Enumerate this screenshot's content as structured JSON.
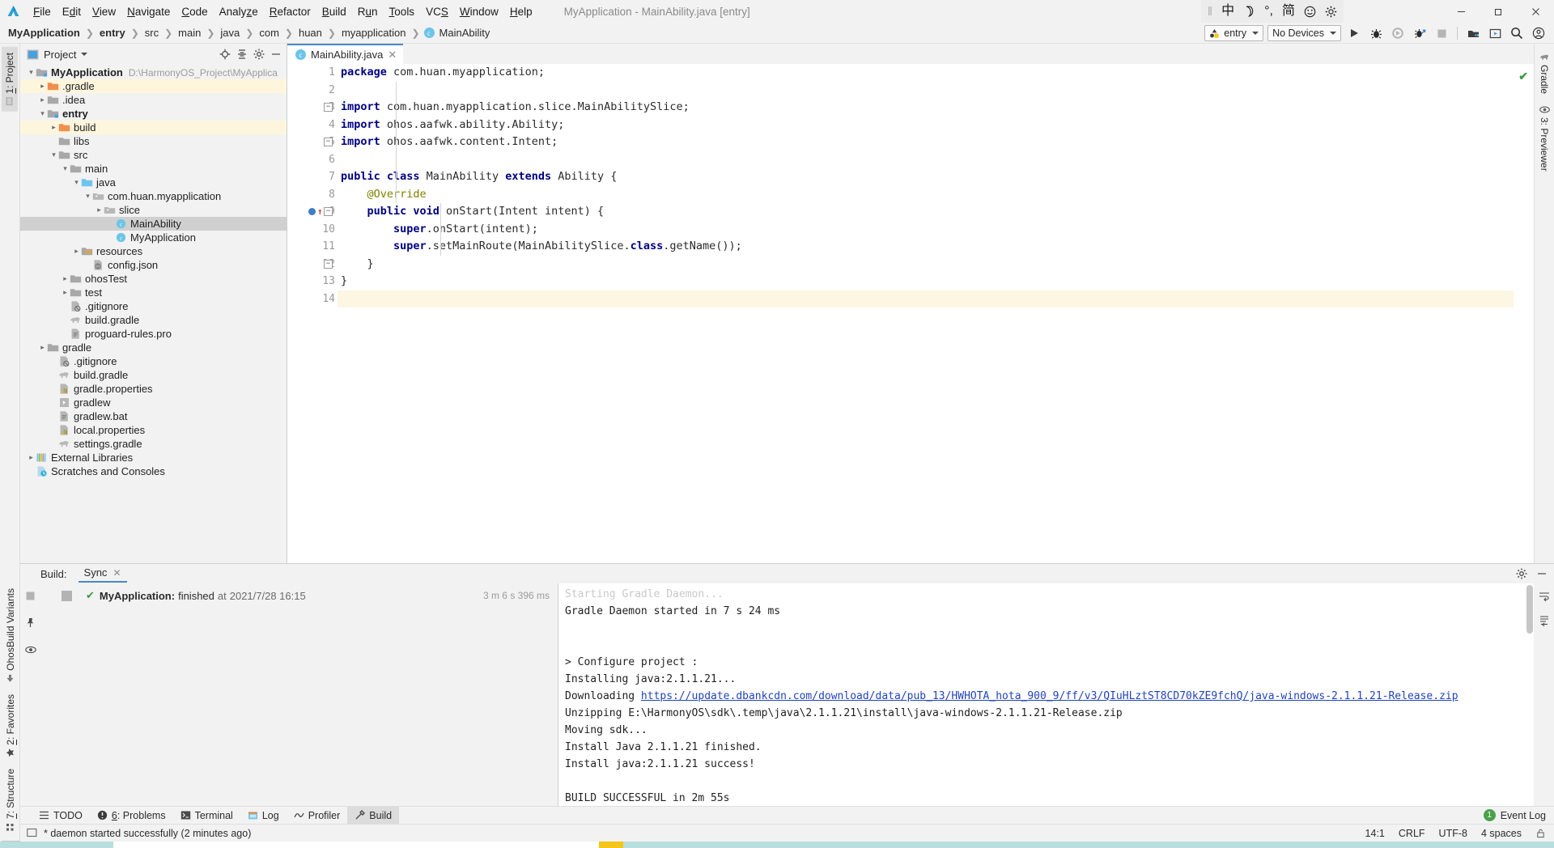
{
  "window": {
    "title": "MyApplication - MainAbility.java [entry]",
    "minimize": "—",
    "maximize": "❐",
    "close": "✕"
  },
  "menu": {
    "items": [
      {
        "label": "File",
        "mnemonic": "F"
      },
      {
        "label": "Edit",
        "mnemonic": "E"
      },
      {
        "label": "View",
        "mnemonic": "V"
      },
      {
        "label": "Navigate",
        "mnemonic": "N"
      },
      {
        "label": "Code",
        "mnemonic": "C"
      },
      {
        "label": "Analyze",
        "mnemonic": "z"
      },
      {
        "label": "Refactor",
        "mnemonic": "R"
      },
      {
        "label": "Build",
        "mnemonic": "B"
      },
      {
        "label": "Run",
        "mnemonic": "u"
      },
      {
        "label": "Tools",
        "mnemonic": "T"
      },
      {
        "label": "VCS",
        "mnemonic": "S"
      },
      {
        "label": "Window",
        "mnemonic": "W"
      },
      {
        "label": "Help",
        "mnemonic": "H"
      }
    ]
  },
  "ime": {
    "items": [
      "中",
      "☽",
      "°,",
      "简",
      "☺",
      "⚙"
    ]
  },
  "breadcrumb": {
    "items": [
      "MyApplication",
      "entry",
      "src",
      "main",
      "java",
      "com",
      "huan",
      "myapplication",
      "MainAbility"
    ],
    "class_badge": "c"
  },
  "toolbar": {
    "module_selector": "entry",
    "device_selector": "No Devices",
    "run_title": "Run",
    "debug_title": "Debug",
    "run_coverage_title": "Run with Coverage",
    "profile_title": "Profile",
    "stop_title": "Stop",
    "sdk_manager_title": "SDK Manager",
    "previewer_title": "Previewer",
    "search_title": "Search Everywhere",
    "account_title": "Account"
  },
  "left_rail": {
    "top": [
      {
        "label": "1: Project",
        "mnemonic": "1",
        "selected": true
      }
    ],
    "bottom": [
      {
        "label": "7: Structure",
        "mnemonic": "7"
      },
      {
        "label": "2: Favorites",
        "mnemonic": "2"
      },
      {
        "label": "OhosBuild Variants",
        "mnemonic": ""
      }
    ]
  },
  "right_rail": {
    "items": [
      {
        "label": "Gradle"
      },
      {
        "label": "3: Previewer",
        "mnemonic": "3"
      }
    ]
  },
  "project_panel": {
    "title": "Project",
    "locate_title": "Select Opened File",
    "collapse_title": "Collapse All",
    "settings_title": "Settings",
    "hide_title": "Hide",
    "root_path": "D:\\HarmonyOS_Project\\MyApplica",
    "tree": [
      {
        "label": "MyApplication",
        "depth": 0,
        "arrow": "v",
        "icon": "module",
        "bold": true,
        "path": true
      },
      {
        "label": ".gradle",
        "depth": 1,
        "arrow": ">",
        "icon": "folder-orange",
        "hl": true
      },
      {
        "label": ".idea",
        "depth": 1,
        "arrow": ">",
        "icon": "folder"
      },
      {
        "label": "entry",
        "depth": 1,
        "arrow": "v",
        "icon": "module",
        "bold": true
      },
      {
        "label": "build",
        "depth": 2,
        "arrow": ">",
        "icon": "folder-orange",
        "hl": true
      },
      {
        "label": "libs",
        "depth": 2,
        "arrow": "",
        "icon": "folder"
      },
      {
        "label": "src",
        "depth": 2,
        "arrow": "v",
        "icon": "folder"
      },
      {
        "label": "main",
        "depth": 3,
        "arrow": "v",
        "icon": "folder"
      },
      {
        "label": "java",
        "depth": 4,
        "arrow": "v",
        "icon": "folder-blue"
      },
      {
        "label": "com.huan.myapplication",
        "depth": 5,
        "arrow": "v",
        "icon": "package"
      },
      {
        "label": "slice",
        "depth": 6,
        "arrow": ">",
        "icon": "package"
      },
      {
        "label": "MainAbility",
        "depth": 7,
        "arrow": "",
        "icon": "class",
        "selected": true
      },
      {
        "label": "MyApplication",
        "depth": 7,
        "arrow": "",
        "icon": "class"
      },
      {
        "label": "resources",
        "depth": 4,
        "arrow": ">",
        "icon": "folder-res"
      },
      {
        "label": "config.json",
        "depth": 5,
        "arrow": "",
        "icon": "json"
      },
      {
        "label": "ohosTest",
        "depth": 3,
        "arrow": ">",
        "icon": "folder"
      },
      {
        "label": "test",
        "depth": 3,
        "arrow": ">",
        "icon": "folder"
      },
      {
        "label": ".gitignore",
        "depth": 3,
        "arrow": "",
        "icon": "gitignore"
      },
      {
        "label": "build.gradle",
        "depth": 3,
        "arrow": "",
        "icon": "gradle"
      },
      {
        "label": "proguard-rules.pro",
        "depth": 3,
        "arrow": "",
        "icon": "file"
      },
      {
        "label": "gradle",
        "depth": 1,
        "arrow": ">",
        "icon": "folder"
      },
      {
        "label": ".gitignore",
        "depth": 2,
        "arrow": "",
        "icon": "gitignore"
      },
      {
        "label": "build.gradle",
        "depth": 2,
        "arrow": "",
        "icon": "gradle"
      },
      {
        "label": "gradle.properties",
        "depth": 2,
        "arrow": "",
        "icon": "properties"
      },
      {
        "label": "gradlew",
        "depth": 2,
        "arrow": "",
        "icon": "script"
      },
      {
        "label": "gradlew.bat",
        "depth": 2,
        "arrow": "",
        "icon": "file"
      },
      {
        "label": "local.properties",
        "depth": 2,
        "arrow": "",
        "icon": "properties"
      },
      {
        "label": "settings.gradle",
        "depth": 2,
        "arrow": "",
        "icon": "gradle"
      },
      {
        "label": "External Libraries",
        "depth": 0,
        "arrow": ">",
        "icon": "libraries"
      },
      {
        "label": "Scratches and Consoles",
        "depth": 0,
        "arrow": "",
        "icon": "scratches"
      }
    ]
  },
  "editor": {
    "tab": {
      "label": "MainAbility.java",
      "badge": "c",
      "close": "✕"
    },
    "inspection_ok": "✔",
    "lines": [
      {
        "n": 1,
        "segments": [
          {
            "t": "package",
            "c": "kw"
          },
          {
            "t": " com.huan.myapplication;",
            "c": "pl"
          }
        ]
      },
      {
        "n": 2,
        "segments": []
      },
      {
        "n": 3,
        "fold": "−",
        "segments": [
          {
            "t": "import",
            "c": "kw"
          },
          {
            "t": " com.huan.myapplication.slice.MainAbilitySlice;",
            "c": "pl"
          }
        ]
      },
      {
        "n": 4,
        "segments": [
          {
            "t": "import",
            "c": "kw"
          },
          {
            "t": " ohos.aafwk.ability.Ability;",
            "c": "pl"
          }
        ]
      },
      {
        "n": 5,
        "fold": "−",
        "segments": [
          {
            "t": "import",
            "c": "kw"
          },
          {
            "t": " ohos.aafwk.content.Intent;",
            "c": "pl"
          }
        ]
      },
      {
        "n": 6,
        "segments": []
      },
      {
        "n": 7,
        "segments": [
          {
            "t": "public class",
            "c": "kw"
          },
          {
            "t": " MainAbility ",
            "c": "pl"
          },
          {
            "t": "extends",
            "c": "kw"
          },
          {
            "t": " Ability {",
            "c": "pl"
          }
        ]
      },
      {
        "n": 8,
        "segments": [
          {
            "t": "    @Override",
            "c": "anno"
          }
        ]
      },
      {
        "n": 9,
        "breakpoint": true,
        "override": true,
        "fold": "−",
        "segments": [
          {
            "t": "    ",
            "c": "pl"
          },
          {
            "t": "public void",
            "c": "kw"
          },
          {
            "t": " onStart(Intent intent) {",
            "c": "pl"
          }
        ]
      },
      {
        "n": 10,
        "segments": [
          {
            "t": "        ",
            "c": "pl"
          },
          {
            "t": "super",
            "c": "kw"
          },
          {
            "t": ".onStart(intent);",
            "c": "pl"
          }
        ]
      },
      {
        "n": 11,
        "segments": [
          {
            "t": "        ",
            "c": "pl"
          },
          {
            "t": "super",
            "c": "kw"
          },
          {
            "t": ".setMainRoute(MainAbilitySlice.",
            "c": "pl"
          },
          {
            "t": "class",
            "c": "kw"
          },
          {
            "t": ".getName());",
            "c": "pl"
          }
        ]
      },
      {
        "n": 12,
        "fold": "−",
        "segments": [
          {
            "t": "    }",
            "c": "pl"
          }
        ]
      },
      {
        "n": 13,
        "segments": [
          {
            "t": "}",
            "c": "pl"
          }
        ]
      },
      {
        "n": 14,
        "current": true,
        "segments": []
      }
    ]
  },
  "build_panel": {
    "label": "Build:",
    "tab": {
      "label": "Sync",
      "close": "✕"
    },
    "settings_title": "Settings",
    "hide_title": "Hide",
    "tree_row": {
      "check": "✔",
      "name": "MyApplication:",
      "status": "finished",
      "at": "at",
      "time": "2021/7/28 16:15",
      "duration": "3 m 6 s 396 ms"
    },
    "console": [
      {
        "text": "Starting Gradle Daemon...",
        "clipped": true
      },
      {
        "text": "Gradle Daemon started in 7 s 24 ms"
      },
      {
        "text": ""
      },
      {
        "text": ""
      },
      {
        "text": "> Configure project :"
      },
      {
        "text": "Installing java:2.1.1.21..."
      },
      {
        "text": "Downloading ",
        "link": "https://update.dbankcdn.com/download/data/pub_13/HWHOTA_hota_900_9/ff/v3/QIuHLztST8CD70kZE9fchQ/java-windows-2.1.1.21-Release.zip"
      },
      {
        "text": "Unzipping E:\\HarmonyOS\\sdk\\.temp\\java\\2.1.1.21\\install\\java-windows-2.1.1.21-Release.zip"
      },
      {
        "text": "Moving sdk..."
      },
      {
        "text": "Install Java 2.1.1.21 finished."
      },
      {
        "text": "Install java:2.1.1.21 success!"
      },
      {
        "text": ""
      },
      {
        "text": "BUILD SUCCESSFUL in 2m 55s"
      }
    ]
  },
  "tool_tabs": {
    "items": [
      {
        "label": "TODO",
        "icon": "todo-icon",
        "mnemonic": ""
      },
      {
        "label": "6: Problems",
        "icon": "problems-icon",
        "mnemonic": "6"
      },
      {
        "label": "Terminal",
        "icon": "terminal-icon",
        "mnemonic": ""
      },
      {
        "label": "Log",
        "icon": "log-icon",
        "mnemonic": ""
      },
      {
        "label": "Profiler",
        "icon": "profiler-icon",
        "mnemonic": ""
      },
      {
        "label": "Build",
        "icon": "build-icon",
        "mnemonic": "",
        "selected": true
      }
    ],
    "event_log": {
      "count": "1",
      "label": "Event Log"
    }
  },
  "status_bar": {
    "message": "* daemon started successfully (2 minutes ago)",
    "caret": "14:1",
    "line_sep": "CRLF",
    "encoding": "UTF-8",
    "indent": "4 spaces",
    "lock_title": "Toggle read-only"
  }
}
